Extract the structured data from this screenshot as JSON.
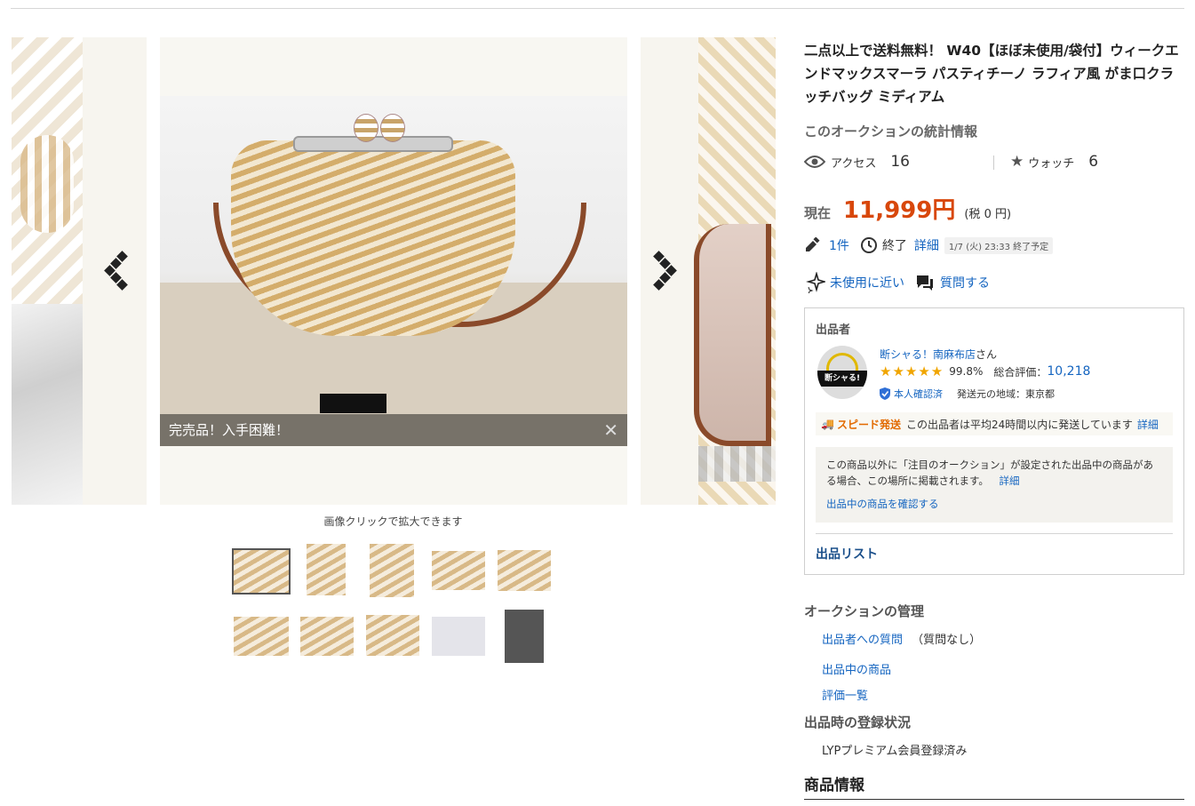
{
  "gallery": {
    "caption": "完売品！入手困難！",
    "zoom_hint": "画像クリックで拡大できます",
    "thumbnail_count": 10
  },
  "listing": {
    "title": "二点以上で送料無料！ W40【ほぼ未使用/袋付】ウィークエンドマックスマーラ パスティチーノ ラフィア風 がま口クラッチバッグ ミディアム",
    "stats_heading": "このオークションの統計情報",
    "access_label": "アクセス",
    "access_count": "16",
    "watch_label": "ウォッチ",
    "watch_count": "6",
    "price_label": "現在",
    "price": "11,999円",
    "tax": "(税 0 円)",
    "bids": "1件",
    "end_label": "終了",
    "detail_link": "詳細",
    "end_time": "1/7 (火) 23:33 終了予定",
    "condition": "未使用に近い",
    "ask_question": "質問する"
  },
  "seller": {
    "heading": "出品者",
    "avatar_text": "断シャる!",
    "name": "断シャる！南麻布店",
    "name_suffix": "さん",
    "rating_percent": "99.8%",
    "total_label": "総合評価：",
    "total_score": "10,218",
    "verified": "本人確認済",
    "region": "発送元の地域：東京都",
    "speed_label": "スピード発送",
    "speed_text": "この出品者は平均24時間以内に発送しています",
    "speed_detail": "詳細",
    "notice_text": "この商品以外に「注目のオークション」が設定された出品中の商品がある場合、この場所に掲載されます。",
    "notice_detail": "詳細",
    "notice_link": "出品中の商品を確認する",
    "list_link": "出品リスト"
  },
  "management": {
    "heading": "オークションの管理",
    "question_link": "出品者への質問",
    "question_note": "（質問なし）",
    "items_link": "出品中の商品",
    "ratings_link": "評価一覧"
  },
  "registration": {
    "heading": "出品時の登録状況",
    "status": "LYPプレミアム会員登録済み"
  },
  "product_info": {
    "heading": "商品情報"
  },
  "colors": {
    "price": "#d8470b",
    "link": "#1565c0",
    "star": "#f0a500"
  }
}
